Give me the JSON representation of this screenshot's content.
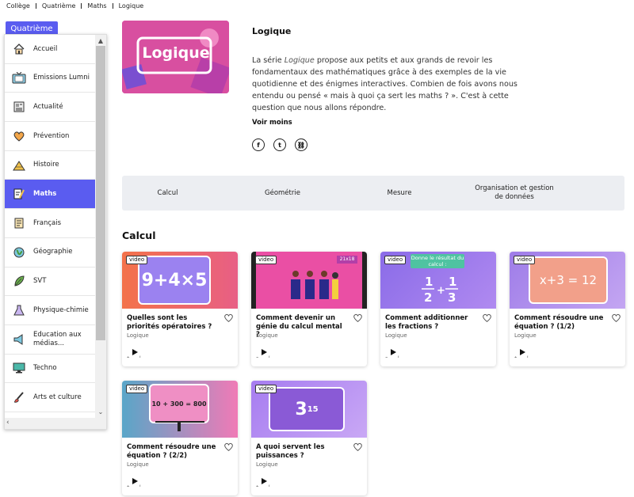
{
  "breadcrumb": [
    "Collège",
    "Quatrième",
    "Maths",
    "Logique"
  ],
  "level": "Quatrième",
  "sidebar": {
    "items": [
      {
        "label": "Accueil",
        "icon": "home-icon",
        "active": false
      },
      {
        "label": "Emissions Lumni",
        "icon": "tv-icon",
        "active": false
      },
      {
        "label": "Actualité",
        "icon": "newspaper-icon",
        "active": false
      },
      {
        "label": "Prévention",
        "icon": "heart-hands-icon",
        "active": false
      },
      {
        "label": "Histoire",
        "icon": "pyramid-icon",
        "active": false
      },
      {
        "label": "Maths",
        "icon": "math-icon",
        "active": true
      },
      {
        "label": "Français",
        "icon": "book-icon",
        "active": false
      },
      {
        "label": "Géographie",
        "icon": "globe-icon",
        "active": false
      },
      {
        "label": "SVT",
        "icon": "leaf-icon",
        "active": false
      },
      {
        "label": "Physique-chimie",
        "icon": "flask-icon",
        "active": false
      },
      {
        "label": "Education aux médias...",
        "icon": "megaphone-icon",
        "active": false
      },
      {
        "label": "Techno",
        "icon": "monitor-icon",
        "active": false
      },
      {
        "label": "Arts et culture",
        "icon": "brush-icon",
        "active": false
      }
    ]
  },
  "serie": {
    "thumb_text": "Logique",
    "title": "Logique",
    "description_before": "La série ",
    "description_em": "Logique",
    "description_after": " propose aux petits et aux grands de revoir les fondamentaux des mathématiques grâce à des exemples de la vie quotidienne et des énigmes interactives. Combien de fois avons nous entendu ou pensé « mais à quoi ça sert les maths ? ». C'est à cette question que nous allons répondre.",
    "voir_moins": "Voir moins",
    "share": [
      "f",
      "t",
      "⛓"
    ]
  },
  "tabs": [
    "Calcul",
    "Géométrie",
    "Mesure",
    "Organisation et gestion de données"
  ],
  "section_title": "Calcul",
  "cards": [
    {
      "badge": "video",
      "title": "Quelles sont les priorités opératoires ?",
      "serie": "Logique",
      "duration": "2min",
      "thumb_text": "9+4×5"
    },
    {
      "badge": "video",
      "title": "Comment devenir un génie du calcul mental ?",
      "serie": "Logique",
      "duration": "3min",
      "thumb_text": "21x18"
    },
    {
      "badge": "video",
      "title": "Comment additionner les fractions ?",
      "serie": "Logique",
      "duration": "3min",
      "thumb_text": "Donne le résultat du calcul :"
    },
    {
      "badge": "video",
      "title": "Comment résoudre une équation ? (1/2)",
      "serie": "Logique",
      "duration": "2min",
      "thumb_text": "x+3 = 12"
    },
    {
      "badge": "video",
      "title": "Comment résoudre une équation ? (2/2)",
      "serie": "Logique",
      "duration": "2min",
      "thumb_text": "10 + 300 = 800"
    },
    {
      "badge": "video",
      "title": "A quoi servent les puissances ?",
      "serie": "Logique",
      "duration": "2min",
      "thumb_text": "3"
    }
  ],
  "colors": {
    "accent": "#5a5cf0",
    "tabs_bg": "#eceef2"
  }
}
